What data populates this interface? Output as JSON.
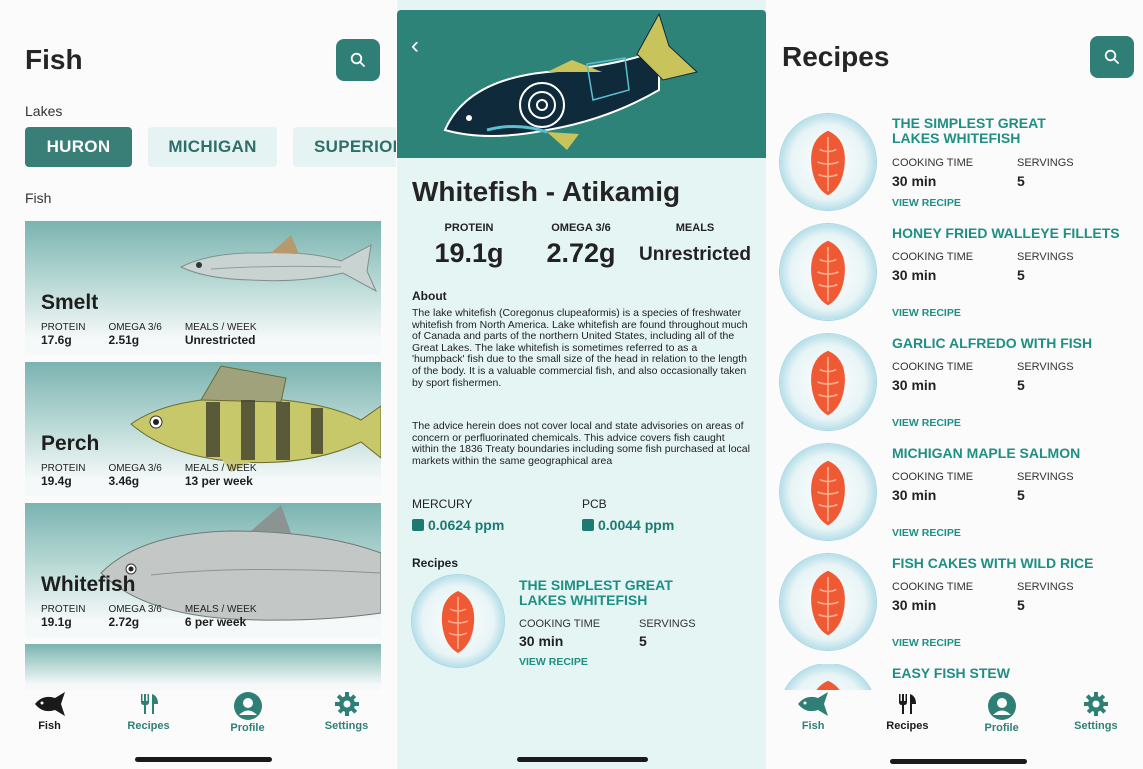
{
  "fish_screen": {
    "title": "Fish",
    "lakes_label": "Lakes",
    "lakes": [
      {
        "label": "HURON",
        "active": true
      },
      {
        "label": "MICHIGAN",
        "active": false
      },
      {
        "label": "SUPERIOR",
        "active": false
      }
    ],
    "fish_label": "Fish",
    "stat_labels": {
      "protein": "PROTEIN",
      "omega": "OMEGA 3/6",
      "meals": "MEALS / WEEK"
    },
    "cards": [
      {
        "name": "Smelt",
        "protein": "17.6g",
        "omega": "2.51g",
        "meals": "Unrestricted"
      },
      {
        "name": "Perch",
        "protein": "19.4g",
        "omega": "3.46g",
        "meals": "13 per week"
      },
      {
        "name": "Whitefish",
        "protein": "19.1g",
        "omega": "2.72g",
        "meals": "6 per week"
      }
    ]
  },
  "tabs": [
    {
      "label": "Fish",
      "icon": "fish-icon"
    },
    {
      "label": "Recipes",
      "icon": "fork-knife-icon"
    },
    {
      "label": "Profile",
      "icon": "profile-icon"
    },
    {
      "label": "Settings",
      "icon": "gear-icon"
    }
  ],
  "detail_screen": {
    "title": "Whitefish - Atikamig",
    "stats": [
      {
        "label": "PROTEIN",
        "value": "19.1g"
      },
      {
        "label": "OMEGA 3/6",
        "value": "2.72g"
      },
      {
        "label": "MEALS",
        "value": "Unrestricted"
      }
    ],
    "about_label": "About",
    "about_p1": "The lake whitefish (Coregonus clupeaformis) is a species of freshwater whitefish from North America. Lake whitefish are found throughout much of Canada and parts of the northern United States, including all of the Great Lakes. The lake whitefish is sometimes referred to as a 'humpback' fish due to the small size of the head in relation to the length of the body. It is a valuable commercial fish, and also occasionally taken by sport fishermen.",
    "about_p2": "The advice herein does not cover local and state advisories on areas of concern or perfluorinated chemicals. This advice covers fish caught within the 1836 Treaty boundaries including some fish purchased at local markets within the same geographical area",
    "mercury_label": "MERCURY",
    "mercury_value": "0.0624 ppm",
    "pcb_label": "PCB",
    "pcb_value": "0.0044 ppm",
    "recipes_label": "Recipes",
    "recipe": {
      "title": "THE SIMPLEST GREAT LAKES WHITEFISH",
      "time_label": "COOKING TIME",
      "time": "30 min",
      "servings_label": "SERVINGS",
      "servings": "5",
      "link": "VIEW RECIPE"
    }
  },
  "recipes_screen": {
    "title": "Recipes",
    "time_label": "COOKING TIME",
    "servings_label": "SERVINGS",
    "link": "VIEW RECIPE",
    "items": [
      {
        "title": "THE SIMPLEST GREAT LAKES WHITEFISH",
        "time": "30 min",
        "servings": "5"
      },
      {
        "title": "HONEY FRIED WALLEYE FILLETS",
        "time": "30 min",
        "servings": "5"
      },
      {
        "title": "GARLIC ALFREDO WITH FISH",
        "time": "30 min",
        "servings": "5"
      },
      {
        "title": "MICHIGAN MAPLE SALMON",
        "time": "30 min",
        "servings": "5"
      },
      {
        "title": "FISH CAKES WITH WILD RICE",
        "time": "30 min",
        "servings": "5"
      },
      {
        "title": "EASY FISH STEW"
      }
    ]
  },
  "colors": {
    "accent": "#2f7f76",
    "link": "#1f8f84",
    "chip_bg": "#e5f3f2"
  }
}
